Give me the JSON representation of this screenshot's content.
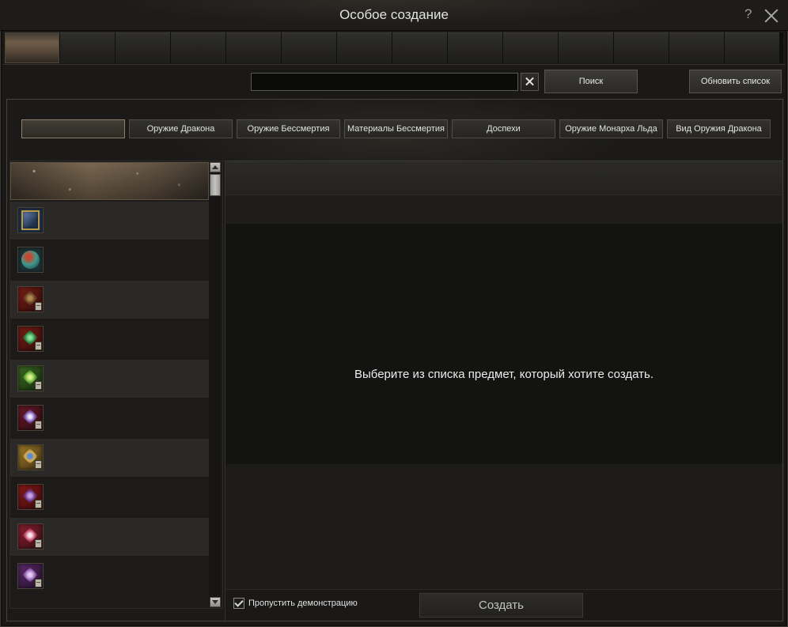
{
  "window": {
    "title": "Особое создание",
    "help_label": "?",
    "close_icon": "close-icon"
  },
  "tabs": [
    {
      "active": true
    },
    {
      "active": false
    },
    {
      "active": false
    },
    {
      "active": false
    },
    {
      "active": false
    },
    {
      "active": false
    },
    {
      "active": false
    },
    {
      "active": false
    },
    {
      "active": false
    },
    {
      "active": false
    },
    {
      "active": false
    },
    {
      "active": false
    },
    {
      "active": false
    },
    {
      "active": false
    }
  ],
  "search": {
    "value": "",
    "clear_icon": "clear-icon",
    "search_label": "Поиск",
    "refresh_label": "Обновить список"
  },
  "categories": [
    {
      "label": "",
      "selected": true
    },
    {
      "label": "Оружие Дракона",
      "selected": false
    },
    {
      "label": "Оружие Бессмертия",
      "selected": false
    },
    {
      "label": "Материалы Бессмертия",
      "selected": false
    },
    {
      "label": "Доспехи",
      "selected": false
    },
    {
      "label": "Оружие Монарха Льда",
      "selected": false
    },
    {
      "label": "Вид Оружия Дракона",
      "selected": false
    }
  ],
  "item_list": {
    "items": [
      {
        "icon": "",
        "selected": true
      },
      {
        "icon": "spellbook-icon",
        "colors": [
          "#22344c",
          "#b8974a",
          "#6a8ab8"
        ],
        "recipe_badge": false
      },
      {
        "icon": "orb-icon",
        "colors": [
          "#1e3236",
          "#3f9a8e",
          "#c04a34"
        ],
        "recipe_badge": false
      },
      {
        "icon": "recipe-icon",
        "colors": [
          "#7a1e18",
          "#6a4426",
          "#b08a50"
        ],
        "recipe_badge": true
      },
      {
        "icon": "recipe-icon",
        "colors": [
          "#7a1e18",
          "#2f8a44",
          "#8ae09a"
        ],
        "recipe_badge": true
      },
      {
        "icon": "recipe-icon",
        "colors": [
          "#3a6a22",
          "#6ab040",
          "#d8f08a"
        ],
        "recipe_badge": true
      },
      {
        "icon": "recipe-icon",
        "colors": [
          "#6a1a2a",
          "#7a5ab0",
          "#ece0ff"
        ],
        "recipe_badge": true
      },
      {
        "icon": "recipe-icon",
        "colors": [
          "#a07a2a",
          "#d8b050",
          "#5a8ad0"
        ],
        "recipe_badge": true
      },
      {
        "icon": "recipe-icon",
        "colors": [
          "#8a1a1a",
          "#6a3a8a",
          "#c8a0e0"
        ],
        "recipe_badge": true
      },
      {
        "icon": "recipe-icon",
        "colors": [
          "#8a2030",
          "#c85070",
          "#f4e4ec"
        ],
        "recipe_badge": true
      },
      {
        "icon": "recipe-icon",
        "colors": [
          "#5a2a6a",
          "#9a6ab8",
          "#e4ccf4"
        ],
        "recipe_badge": true
      }
    ]
  },
  "scrollbar": {
    "up_icon": "arrow-up-icon",
    "down_icon": "arrow-down-icon",
    "scroll_position": 0
  },
  "details": {
    "message": "Выберите из списка предмет, который хотите создать."
  },
  "footer": {
    "skip_demo_label": "Пропустить демонстрацию",
    "skip_demo_checked": true,
    "check_icon": "check-icon",
    "create_label": "Создать"
  },
  "theme": {
    "accent": "#6f5d48",
    "selected_border": "#8a806c",
    "text": "#e2e2e2",
    "panel_bg": "#1b1a18"
  }
}
